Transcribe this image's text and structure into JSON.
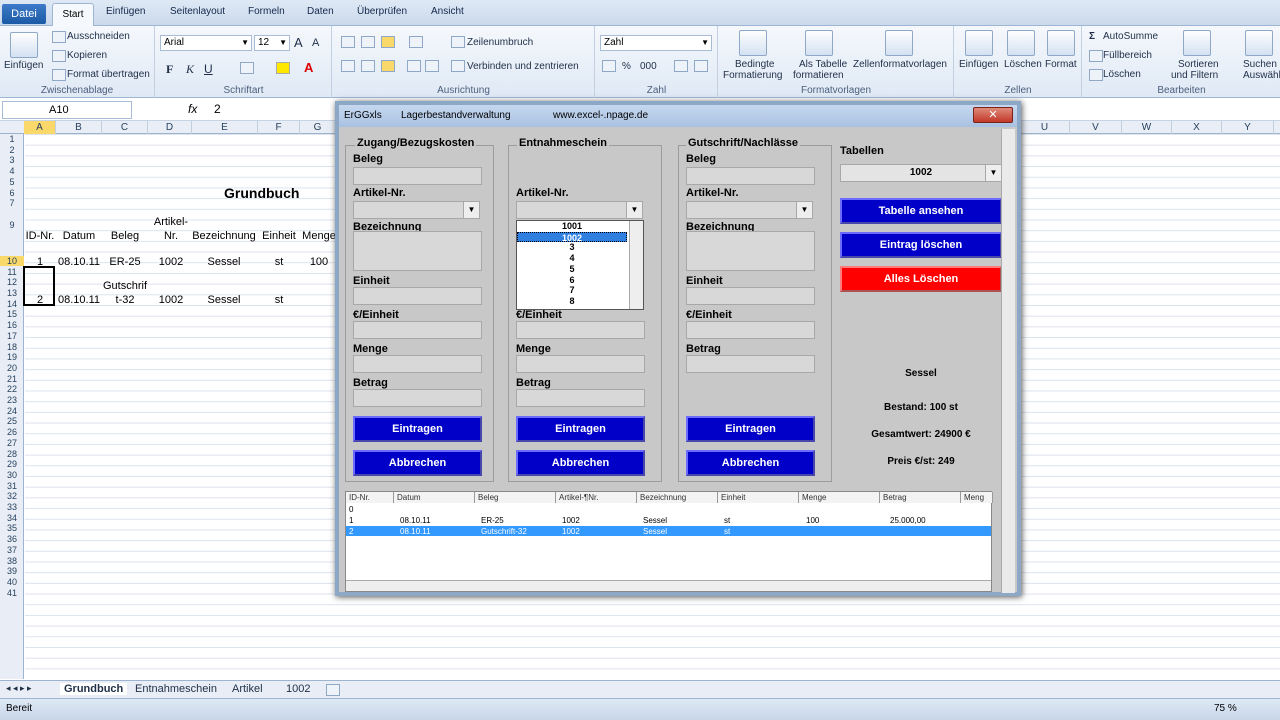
{
  "ribbon_tabs": {
    "file": "Datei",
    "start": "Start",
    "insert": "Einfügen",
    "layout": "Seitenlayout",
    "formulas": "Formeln",
    "data": "Daten",
    "review": "Überprüfen",
    "view": "Ansicht"
  },
  "clipboard": {
    "paste": "Einfügen",
    "cut": "Ausschneiden",
    "copy": "Kopieren",
    "format_painter": "Format übertragen",
    "group": "Zwischenablage"
  },
  "font": {
    "name": "Arial",
    "size": "12",
    "group": "Schriftart"
  },
  "alignment": {
    "wrap": "Zeilenumbruch",
    "merge": "Verbinden und zentrieren",
    "group": "Ausrichtung"
  },
  "number": {
    "format": "Zahl",
    "group": "Zahl"
  },
  "styles": {
    "conditional": "Bedingte",
    "conditional2": "Formatierung",
    "as_table": "Als Tabelle",
    "as_table2": "formatieren",
    "cell_styles": "Zellenformatvorlagen",
    "group": "Formatvorlagen"
  },
  "cells": {
    "insert": "Einfügen",
    "delete": "Löschen",
    "format": "Format",
    "group": "Zellen"
  },
  "editing": {
    "autosum": "AutoSumme",
    "fill": "Füllbereich",
    "clear": "Löschen",
    "sort": "Sortieren",
    "sort2": "und Filtern",
    "find": "Suchen und",
    "find2": "Auswählen",
    "group": "Bearbeiten"
  },
  "formula_bar": {
    "name_box": "A10",
    "fx": "fx",
    "value": "2"
  },
  "columns": [
    "A",
    "B",
    "C",
    "D",
    "E",
    "F",
    "G",
    "U",
    "V",
    "W",
    "X",
    "Y"
  ],
  "rows": [
    "1",
    "2",
    "3",
    "4",
    "5",
    "6",
    "7",
    "9",
    "10",
    "11",
    "12",
    "13",
    "14",
    "15",
    "16",
    "17",
    "18",
    "19",
    "20",
    "21",
    "22",
    "23",
    "24",
    "25",
    "26",
    "27",
    "28",
    "29",
    "30",
    "31",
    "32",
    "33",
    "34",
    "35",
    "36",
    "37",
    "38",
    "39",
    "40",
    "41"
  ],
  "sheet": {
    "title": "Grundbuch",
    "headers": [
      "ID-Nr.",
      "Datum",
      "Beleg",
      "Artikel-",
      "Nr.",
      "Bezeichnung",
      "Einheit",
      "Menge"
    ],
    "row1": [
      "1",
      "08.10.11",
      "ER-25",
      "1002",
      "Sessel",
      "st",
      "100"
    ],
    "row2": [
      "2",
      "08.10.11",
      "Gutschrif",
      "t-32",
      "1002",
      "Sessel",
      "st"
    ]
  },
  "sheet_tabs": [
    "Grundbuch",
    "Entnahmeschein",
    "Artikel",
    "1002"
  ],
  "status": {
    "ready": "Bereit",
    "zoom": "75 %"
  },
  "form": {
    "title1": "ErGGxls",
    "title2": "Lagerbestandverwaltung",
    "title3": "www.excel-.npage.de",
    "close": "✕",
    "frame1": {
      "title": "Zugang/Bezugskosten",
      "beleg": "Beleg",
      "artikel": "Artikel-Nr.",
      "bezeichnung": "Bezeichnung",
      "einheit": "Einheit",
      "preis": "€/Einheit",
      "menge": "Menge",
      "betrag": "Betrag",
      "save": "Eintragen",
      "cancel": "Abbrechen"
    },
    "frame2": {
      "title": "Entnahmeschein",
      "artikel": "Artikel-Nr.",
      "preis": "€/Einheit",
      "menge": "Menge",
      "betrag": "Betrag",
      "save": "Eintragen",
      "cancel": "Abbrechen"
    },
    "frame3": {
      "title": "Gutschrift/Nachlässe",
      "beleg": "Beleg",
      "artikel": "Artikel-Nr.",
      "bezeichnung": "Bezeichnung",
      "einheit": "Einheit",
      "preis": "€/Einheit",
      "betrag": "Betrag",
      "save": "Eintragen",
      "cancel": "Abbrechen"
    },
    "list_items": [
      "1001",
      "1002",
      "3",
      "4",
      "5",
      "6",
      "7",
      "8"
    ],
    "tables_label": "Tabellen",
    "tables_value": "1002",
    "btn_view": "Tabelle ansehen",
    "btn_delete": "Eintrag löschen",
    "btn_clear": "Alles Löschen",
    "info": {
      "name": "Sessel",
      "stock": "Bestand: 100 st",
      "total": "Gesamtwert: 24900 €",
      "price": "Preis €/st: 249"
    },
    "table_headers": [
      "ID-Nr.",
      "Datum",
      "Beleg",
      "Artikel-¶Nr.",
      "Bezeichnung",
      "Einheit",
      "Menge",
      "Betrag",
      "Meng"
    ],
    "table_rows": [
      [
        "0",
        "",
        "",
        "",
        "",
        "",
        "",
        ""
      ],
      [
        "1",
        "08.10.11",
        "ER-25",
        "1002",
        "Sessel",
        "st",
        "100",
        "25.000,00"
      ],
      [
        "2",
        "08.10.11",
        "Gutschrift-32",
        "1002",
        "Sessel",
        "st",
        "",
        ""
      ]
    ]
  }
}
